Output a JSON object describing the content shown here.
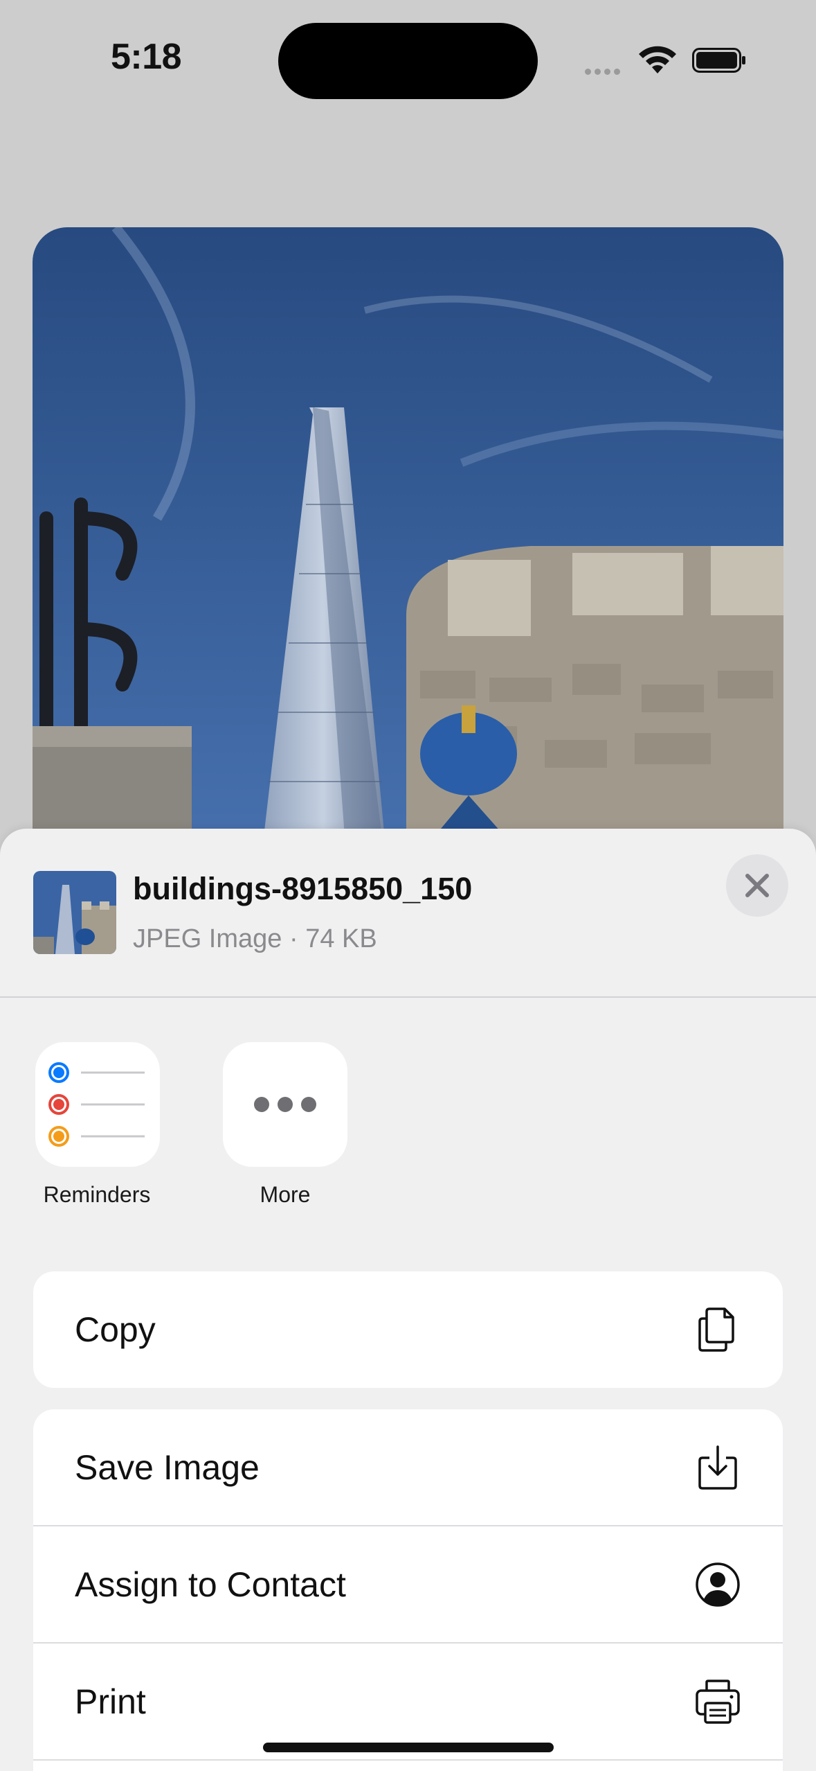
{
  "status_bar": {
    "time": "5:18"
  },
  "share_sheet": {
    "file_name": "buildings-8915850_150",
    "file_info": "JPEG Image · 74 KB",
    "apps": [
      {
        "label": "Reminders",
        "icon": "reminders-icon"
      },
      {
        "label": "More",
        "icon": "more-icon"
      }
    ],
    "actions": [
      {
        "label": "Copy",
        "icon": "copy-icon"
      },
      {
        "label": "Save Image",
        "icon": "save-image-icon"
      },
      {
        "label": "Assign to Contact",
        "icon": "contact-icon"
      },
      {
        "label": "Print",
        "icon": "print-icon"
      }
    ]
  },
  "colors": {
    "sky": "#2f5a9a",
    "reminder_blue": "#0a7aff",
    "reminder_red": "#e5453b",
    "reminder_orange": "#f49c1a"
  }
}
